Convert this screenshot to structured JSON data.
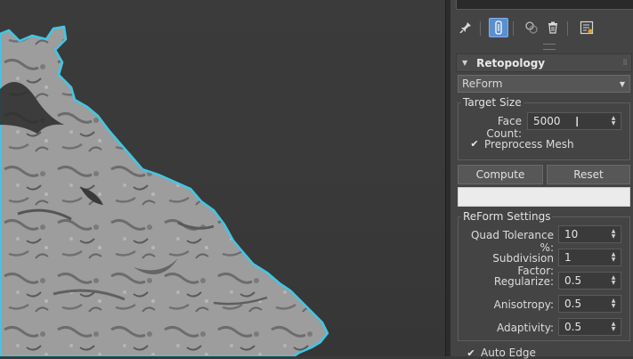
{
  "toolbar": {
    "icons": [
      "pin-icon",
      "modifier-stack-icon",
      "make-unique-icon",
      "delete-icon",
      "configure-icon"
    ]
  },
  "rollout": {
    "title": "Retopology",
    "mode_selected": "ReForm"
  },
  "target_size": {
    "group_label": "Target Size",
    "face_count_label": "Face Count:",
    "face_count_value": "5000",
    "preprocess_label": "Preprocess Mesh",
    "preprocess_checked": true
  },
  "actions": {
    "compute_label": "Compute",
    "reset_label": "Reset",
    "progress": 0
  },
  "reform_settings": {
    "group_label": "ReForm Settings",
    "quad_tolerance_label": "Quad Tolerance %:",
    "quad_tolerance_value": "10",
    "subdivision_label": "Subdivision Factor:",
    "subdivision_value": "1",
    "regularize_label": "Regularize:",
    "regularize_value": "0.5",
    "anisotropy_label": "Anisotropy:",
    "anisotropy_value": "0.5",
    "adaptivity_label": "Adaptivity:",
    "adaptivity_value": "0.5",
    "auto_edge_label": "Auto Edge",
    "auto_edge_checked": true
  },
  "colors": {
    "selection_outline": "#3ec8e6",
    "active_button": "#5a8fd0",
    "panel_bg": "#444444",
    "viewport_bg": "#3a3a3a"
  }
}
